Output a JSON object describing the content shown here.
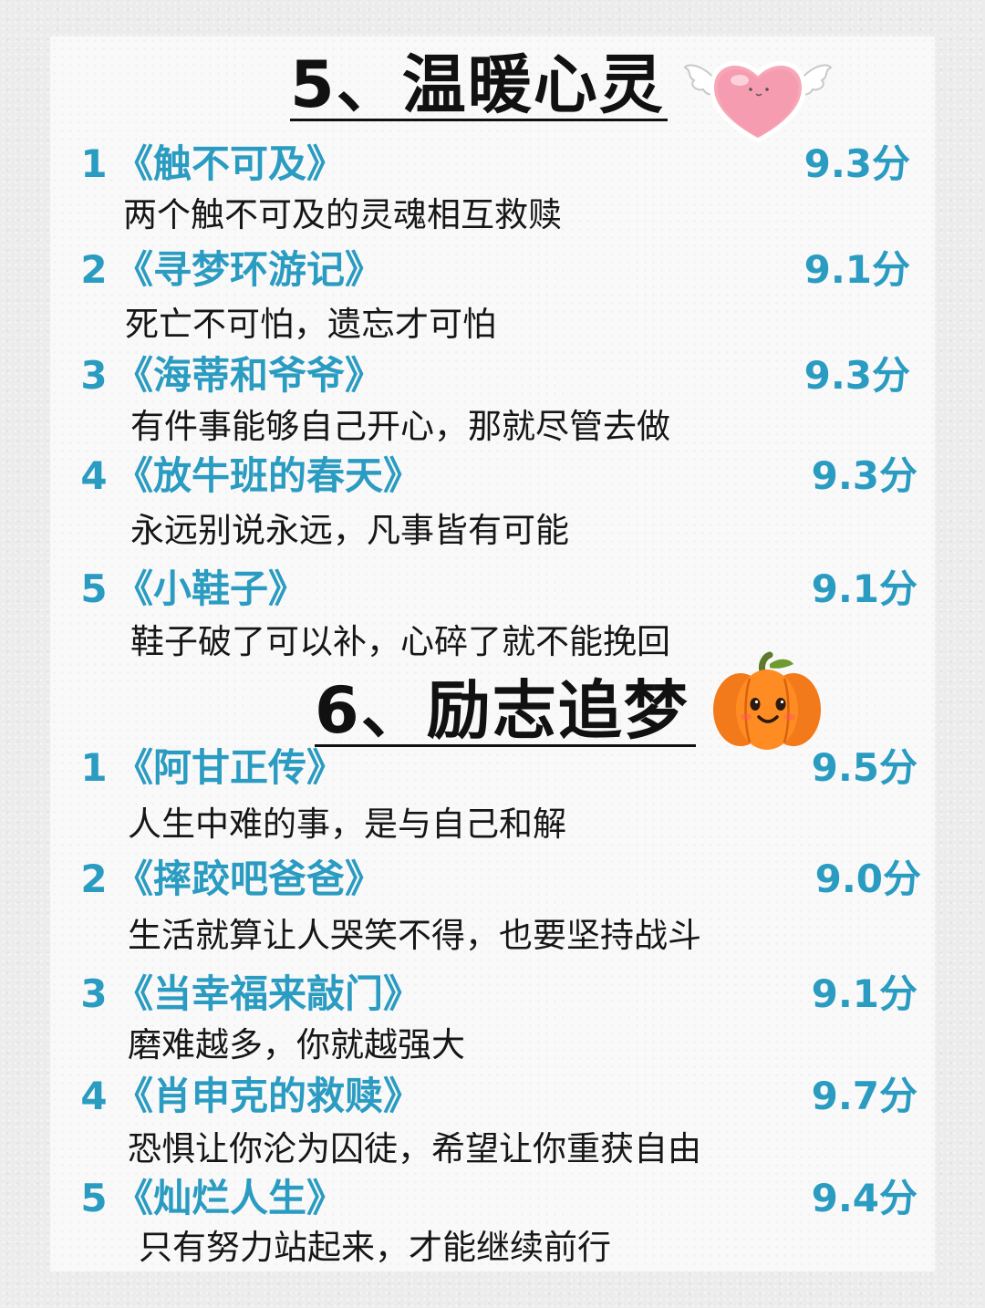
{
  "sections": [
    {
      "heading": "5、温暖心灵",
      "icon": "winged-heart-icon",
      "films": [
        {
          "num": "1",
          "title": "《触不可及》",
          "score": "9.3分",
          "quote": "两个触不可及的灵魂相互救赎"
        },
        {
          "num": "2",
          "title": "《寻梦环游记》",
          "score": "9.1分",
          "quote": "死亡不可怕，遗忘才可怕"
        },
        {
          "num": "3",
          "title": "《海蒂和爷爷》",
          "score": "9.3分",
          "quote": "有件事能够自己开心，那就尽管去做"
        },
        {
          "num": "4",
          "title": "《放牛班的春天》",
          "score": "9.3分",
          "quote": "永远别说永远，凡事皆有可能"
        },
        {
          "num": "5",
          "title": "《小鞋子》",
          "score": "9.1分",
          "quote": "鞋子破了可以补，心碎了就不能挽回"
        }
      ]
    },
    {
      "heading": "6、励志追梦",
      "icon": "pumpkin-icon",
      "films": [
        {
          "num": "1",
          "title": "《阿甘正传》",
          "score": "9.5分",
          "quote": "人生中难的事，是与自己和解"
        },
        {
          "num": "2",
          "title": "《摔跤吧爸爸》",
          "score": "9.0分",
          "quote": "生活就算让人哭笑不得，也要坚持战斗"
        },
        {
          "num": "3",
          "title": "《当幸福来敲门》",
          "score": "9.1分",
          "quote": "磨难越多，你就越强大"
        },
        {
          "num": "4",
          "title": "《肖申克的救赎》",
          "score": "9.7分",
          "quote": "恐惧让你沦为囚徒，希望让你重获自由"
        },
        {
          "num": "5",
          "title": "《灿烂人生》",
          "score": "9.4分",
          "quote": "只有努力站起来，才能继续前行"
        }
      ]
    }
  ],
  "colors": {
    "accent": "#2a9bc1",
    "text": "#161616",
    "heading": "#111111",
    "card": "#f9f9f9",
    "background": "#ececec"
  }
}
